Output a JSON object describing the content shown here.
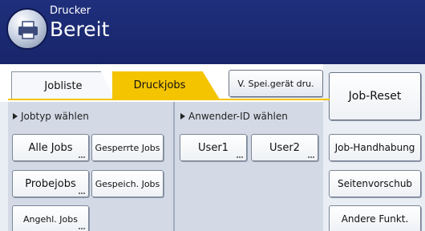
{
  "header": {
    "subtitle": "Drucker",
    "title": "Bereit"
  },
  "tabs": {
    "list_label": "Jobliste",
    "jobs_label": "Druckjobs",
    "active": "Druckjobs"
  },
  "spei_button": "V. Spei.gerät dru.",
  "left_panel": {
    "label": "Jobtyp wählen",
    "buttons": [
      "Alle Jobs",
      "Gesperrte Jobs",
      "Probejobs",
      "Gespeich. Jobs",
      "Angehl. Jobs"
    ]
  },
  "mid_panel": {
    "label": "Anwender-ID wählen",
    "buttons": [
      "User1",
      "User2"
    ]
  },
  "right_panel": {
    "reset": "Job-Reset",
    "buttons": [
      "Job-Handhabung",
      "Seitenvorschub",
      "Andere Funkt."
    ]
  },
  "colors": {
    "header_bg": "#1f2f7c",
    "active_tab": "#f4c400",
    "panel_bg": "#d3dae6"
  }
}
